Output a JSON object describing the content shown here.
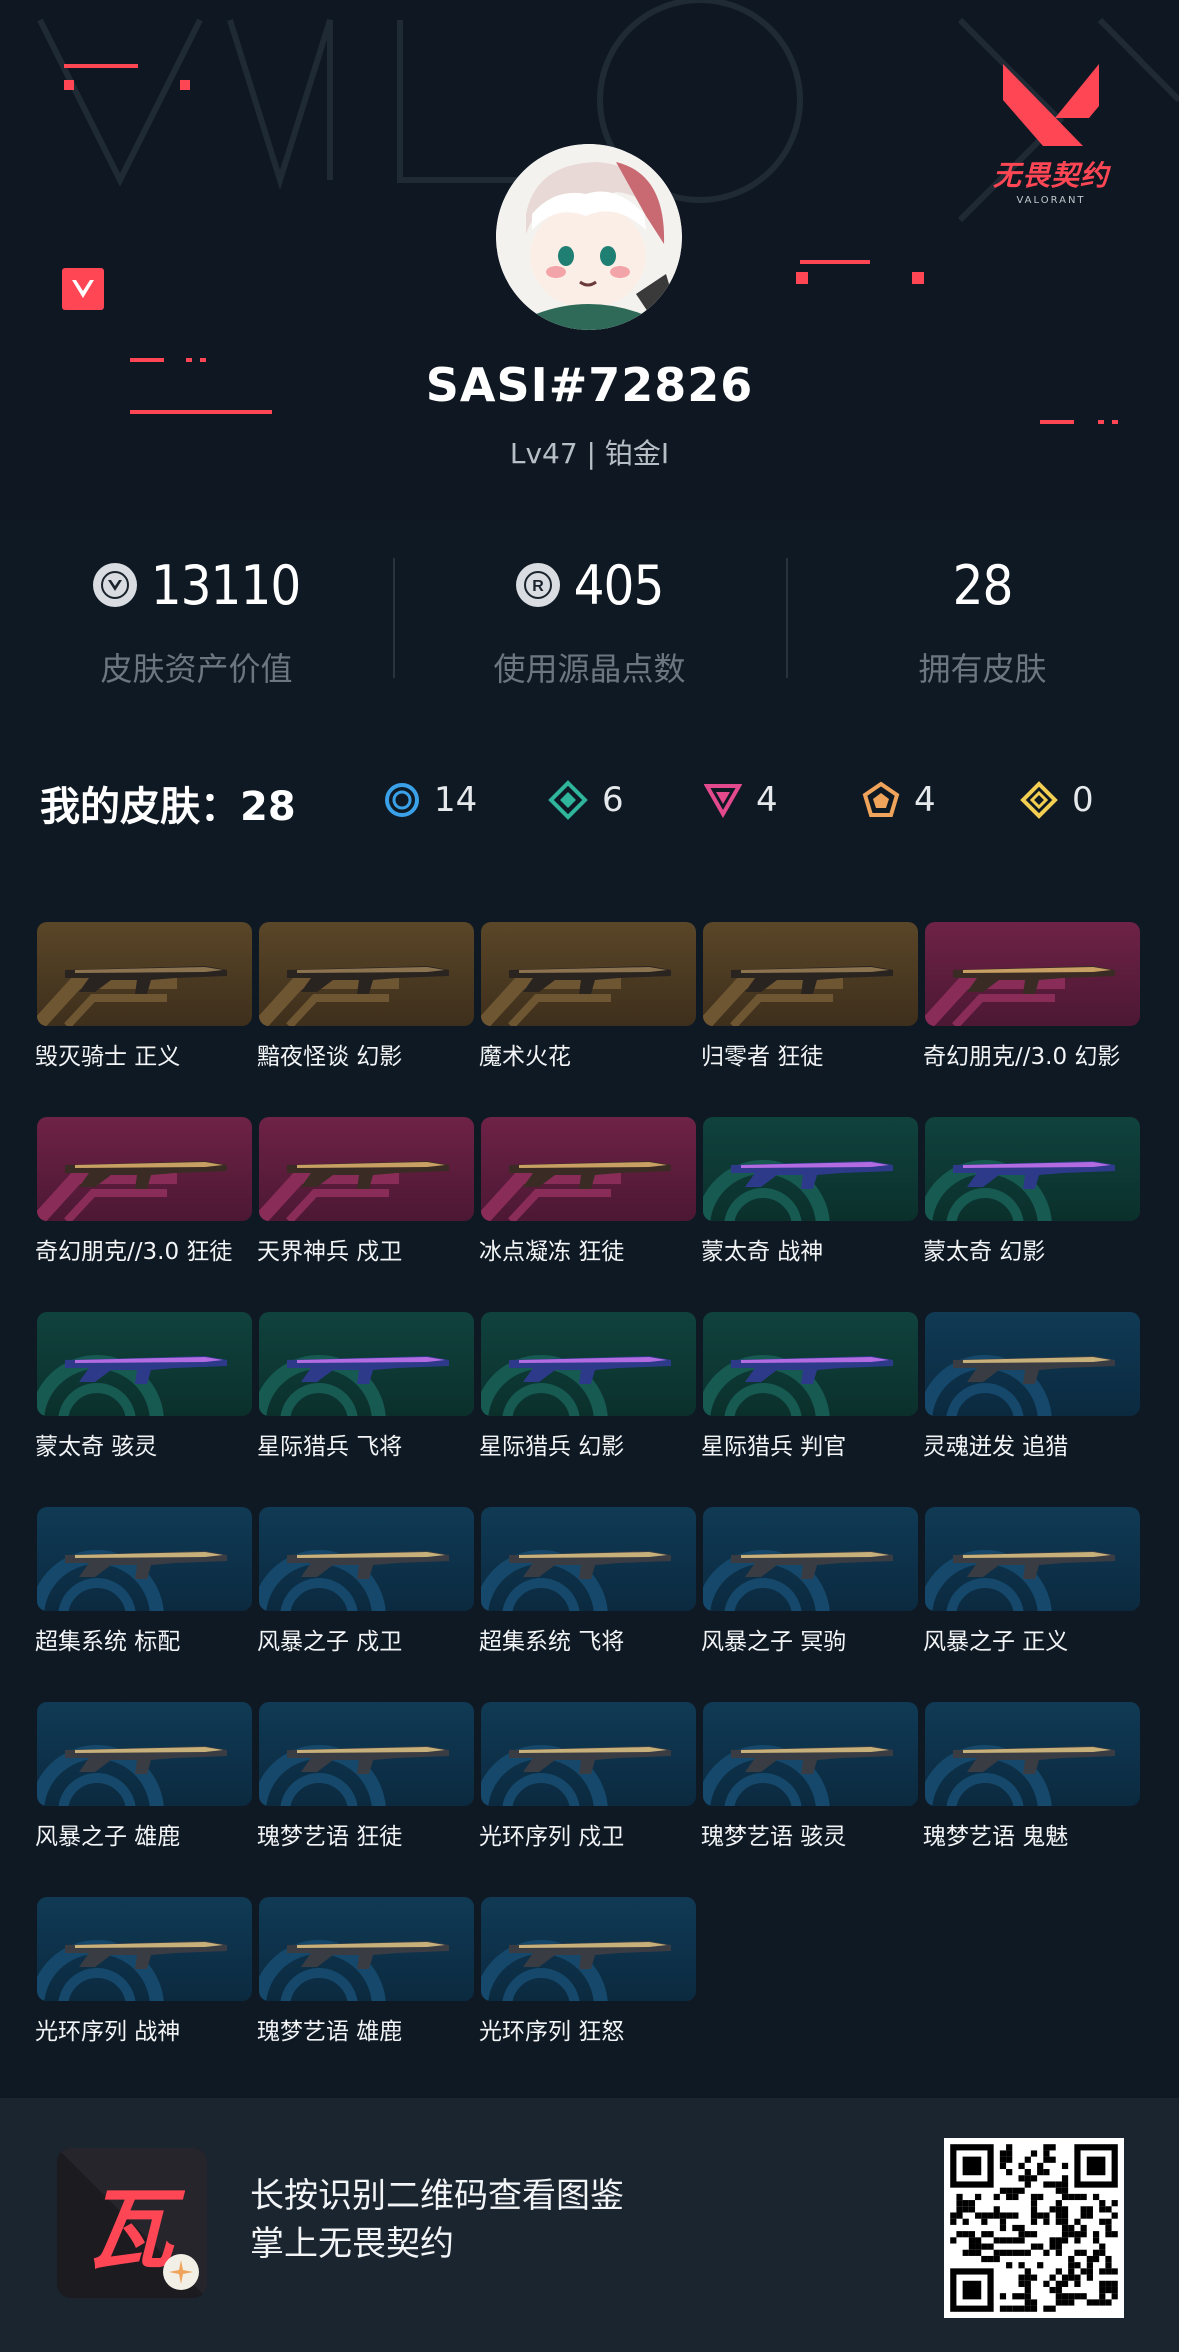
{
  "brand": {
    "name": "无畏契约",
    "sub": "VALORANT"
  },
  "profile": {
    "username": "SASI#72826",
    "level": "Lv47 | 铂金I"
  },
  "stats": [
    {
      "value": "13110",
      "label": "皮肤资产价值",
      "icon": "valorant-points-icon"
    },
    {
      "value": "405",
      "label": "使用源晶点数",
      "icon": "radianite-icon"
    },
    {
      "value": "28",
      "label": "拥有皮肤",
      "icon": ""
    }
  ],
  "skins_header": {
    "title": "我的皮肤：",
    "total": "28"
  },
  "tiers": [
    {
      "icon": "select-tier-icon",
      "color": "#3aa0e8",
      "count": "14"
    },
    {
      "icon": "deluxe-tier-icon",
      "color": "#2fb59b",
      "count": "6"
    },
    {
      "icon": "premium-tier-icon",
      "color": "#e24a8d",
      "count": "4"
    },
    {
      "icon": "exclusive-tier-icon",
      "color": "#f0a35a",
      "count": "4"
    },
    {
      "icon": "ultra-tier-icon",
      "color": "#f2cf52",
      "count": "0"
    }
  ],
  "skins": [
    {
      "name": "毁灭骑士 正义",
      "tier": "gold"
    },
    {
      "name": "黯夜怪谈 幻影",
      "tier": "gold"
    },
    {
      "name": "魔术火花",
      "tier": "gold"
    },
    {
      "name": "归零者 狂徒",
      "tier": "gold"
    },
    {
      "name": "奇幻朋克//3.0 幻影",
      "tier": "magenta"
    },
    {
      "name": "奇幻朋克//3.0 狂徒",
      "tier": "magenta"
    },
    {
      "name": "天界神兵 戍卫",
      "tier": "magenta"
    },
    {
      "name": "冰点凝冻 狂徒",
      "tier": "magenta"
    },
    {
      "name": "蒙太奇 战神",
      "tier": "teal"
    },
    {
      "name": "蒙太奇 幻影",
      "tier": "teal"
    },
    {
      "name": "蒙太奇 骇灵",
      "tier": "teal"
    },
    {
      "name": "星际猎兵 飞将",
      "tier": "teal"
    },
    {
      "name": "星际猎兵 幻影",
      "tier": "teal"
    },
    {
      "name": "星际猎兵 判官",
      "tier": "teal"
    },
    {
      "name": "灵魂迸发 追猎",
      "tier": "blue"
    },
    {
      "name": "超集系统 标配",
      "tier": "blue"
    },
    {
      "name": "风暴之子 戍卫",
      "tier": "blue"
    },
    {
      "name": "超集系统 飞将",
      "tier": "blue"
    },
    {
      "name": "风暴之子 冥驹",
      "tier": "blue"
    },
    {
      "name": "风暴之子 正义",
      "tier": "blue"
    },
    {
      "name": "风暴之子 雄鹿",
      "tier": "blue"
    },
    {
      "name": "瑰梦艺语 狂徒",
      "tier": "blue"
    },
    {
      "name": "光环序列 戍卫",
      "tier": "blue"
    },
    {
      "name": "瑰梦艺语 骇灵",
      "tier": "blue"
    },
    {
      "name": "瑰梦艺语 鬼魅",
      "tier": "blue"
    },
    {
      "name": "光环序列 战神",
      "tier": "blue"
    },
    {
      "name": "瑰梦艺语 雄鹿",
      "tier": "blue"
    },
    {
      "name": "光环序列 狂怒",
      "tier": "blue"
    }
  ],
  "footer": {
    "line1": "长按识别二维码查看图鉴",
    "line2": "掌上无畏契约"
  }
}
